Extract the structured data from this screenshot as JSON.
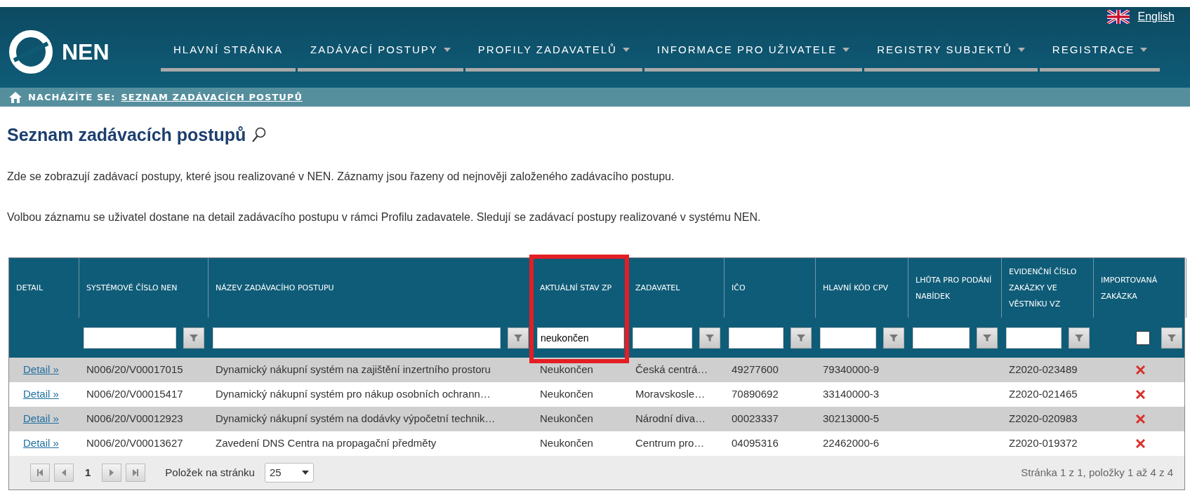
{
  "header": {
    "logo_text": "NEN",
    "language": "English",
    "nav": [
      {
        "label": "HLAVNÍ STRÁNKA",
        "has_menu": false
      },
      {
        "label": "ZADÁVACÍ POSTUPY",
        "has_menu": true
      },
      {
        "label": "PROFILY ZADAVATELŮ",
        "has_menu": true
      },
      {
        "label": "INFORMACE PRO UŽIVATELE",
        "has_menu": true
      },
      {
        "label": "REGISTRY SUBJEKTŮ",
        "has_menu": true
      },
      {
        "label": "REGISTRACE",
        "has_menu": true
      }
    ]
  },
  "breadcrumb": {
    "label": "NACHÁZÍTE SE:",
    "current": "SEZNAM ZADÁVACÍCH POSTUPŮ"
  },
  "page_title": "Seznam zadávacích postupů",
  "paragraphs": [
    "Zde se zobrazují zadávací postupy, které jsou realizované v NEN. Záznamy jsou řazeny od nejnověji založeného zadávacího postupu.",
    "Volbou záznamu se uživatel dostane na detail zadávacího postupu v rámci Profilu zadavatele. Sledují se zadávací postupy realizované v systému NEN."
  ],
  "table": {
    "columns": [
      {
        "label": "DETAIL",
        "filter": {
          "kind": "none"
        }
      },
      {
        "label": "SYSTÉMOVÉ ČÍSLO NEN",
        "filter": {
          "kind": "text"
        }
      },
      {
        "label": "NÁZEV ZADÁVACÍHO POSTUPU",
        "filter": {
          "kind": "text"
        }
      },
      {
        "label": "AKTUÁLNÍ STAV ZP",
        "highlighted": true,
        "filter": {
          "kind": "text",
          "value": "neukončen"
        }
      },
      {
        "label": "ZADAVATEL",
        "filter": {
          "kind": "text"
        }
      },
      {
        "label": "IČO",
        "filter": {
          "kind": "text"
        }
      },
      {
        "label": "HLAVNÍ KÓD CPV",
        "filter": {
          "kind": "text"
        }
      },
      {
        "label": "LHŮTA PRO PODÁNÍ NABÍDEK",
        "filter": {
          "kind": "text"
        }
      },
      {
        "label": "EVIDENČNÍ ČÍSLO ZAKÁZKY VE VĚSTNÍKU VZ",
        "filter": {
          "kind": "text"
        }
      },
      {
        "label": "IMPORTOVANÁ ZAKÁZKA",
        "filter": {
          "kind": "checkbox",
          "checked": false
        }
      }
    ],
    "rows": [
      {
        "detail": "Detail »",
        "number": "N006/20/V00017015",
        "name": "Dynamický nákupní systém na zajištění inzertního prostoru",
        "state": "Neukončen",
        "authority": "Česká centrá…",
        "ico": "49277600",
        "cpv": "79340000-9",
        "journal_no": "Z2020-023489",
        "imported": false
      },
      {
        "detail": "Detail »",
        "number": "N006/20/V00015417",
        "name": "Dynamický nákupní systém pro nákup osobních ochrann…",
        "state": "Neukončen",
        "authority": "Moravskosle…",
        "ico": "70890692",
        "cpv": "33140000-3",
        "journal_no": "Z2020-021465",
        "imported": false
      },
      {
        "detail": "Detail »",
        "number": "N006/20/V00012923",
        "name": "Dynamický nákupní systém na dodávky výpočetní technik…",
        "state": "Neukončen",
        "authority": "Národní diva…",
        "ico": "00023337",
        "cpv": "30213000-5",
        "journal_no": "Z2020-020983",
        "imported": false
      },
      {
        "detail": "Detail »",
        "number": "N006/20/V00013627",
        "name": "Zavedení DNS Centra na propagační předměty",
        "state": "Neukončen",
        "authority": "Centrum pro…",
        "ico": "04095316",
        "cpv": "22462000-6",
        "journal_no": "Z2020-019372",
        "imported": false
      }
    ],
    "pager": {
      "page": "1",
      "page_size_label": "Položek na stránku",
      "page_size": "25",
      "summary": "Stránka 1 z 1, položky 1 až 4 z 4"
    }
  }
}
